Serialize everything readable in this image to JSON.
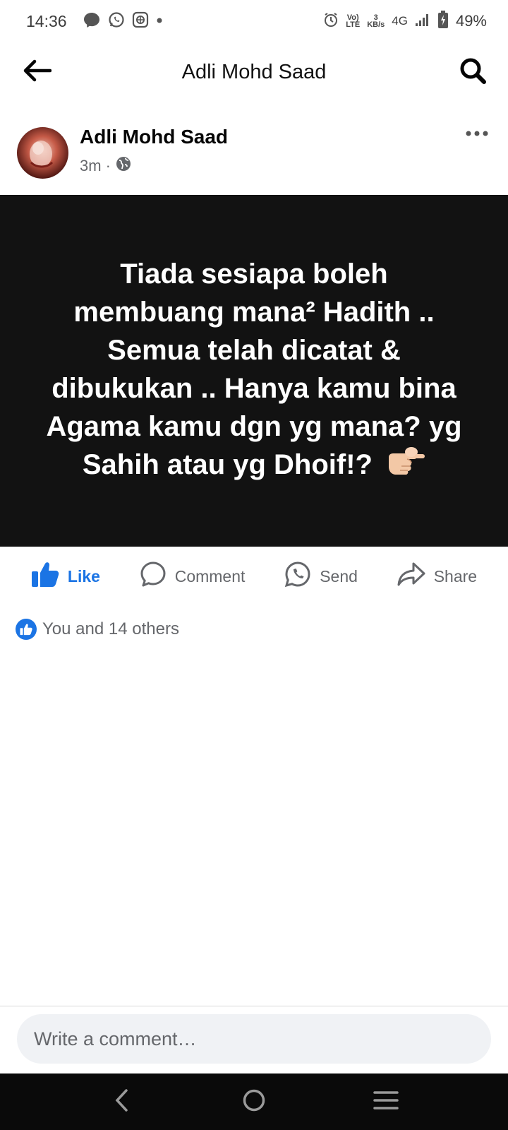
{
  "status_bar": {
    "time": "14:36",
    "volte_top": "Vo)",
    "volte_bottom": "LTE",
    "speed_value": "3",
    "speed_unit": "KB/s",
    "network": "4G",
    "battery_percent": "49%"
  },
  "header": {
    "title": "Adli Mohd Saad"
  },
  "post": {
    "author": "Adli Mohd Saad",
    "time_ago": "3m",
    "separator": "·",
    "text": "Tiada sesiapa boleh membuang mana² Hadith .. Semua telah dicatat & dibukukan .. Hanya kamu bina Agama kamu dgn yg mana? yg Sahih atau yg Dhoif!?",
    "background_color": "#121212"
  },
  "actions": {
    "like": "Like",
    "comment": "Comment",
    "send": "Send",
    "share": "Share",
    "like_color": "#1b74e4"
  },
  "reactions": {
    "summary": "You and 14 others"
  },
  "comment": {
    "placeholder": "Write a comment…"
  }
}
